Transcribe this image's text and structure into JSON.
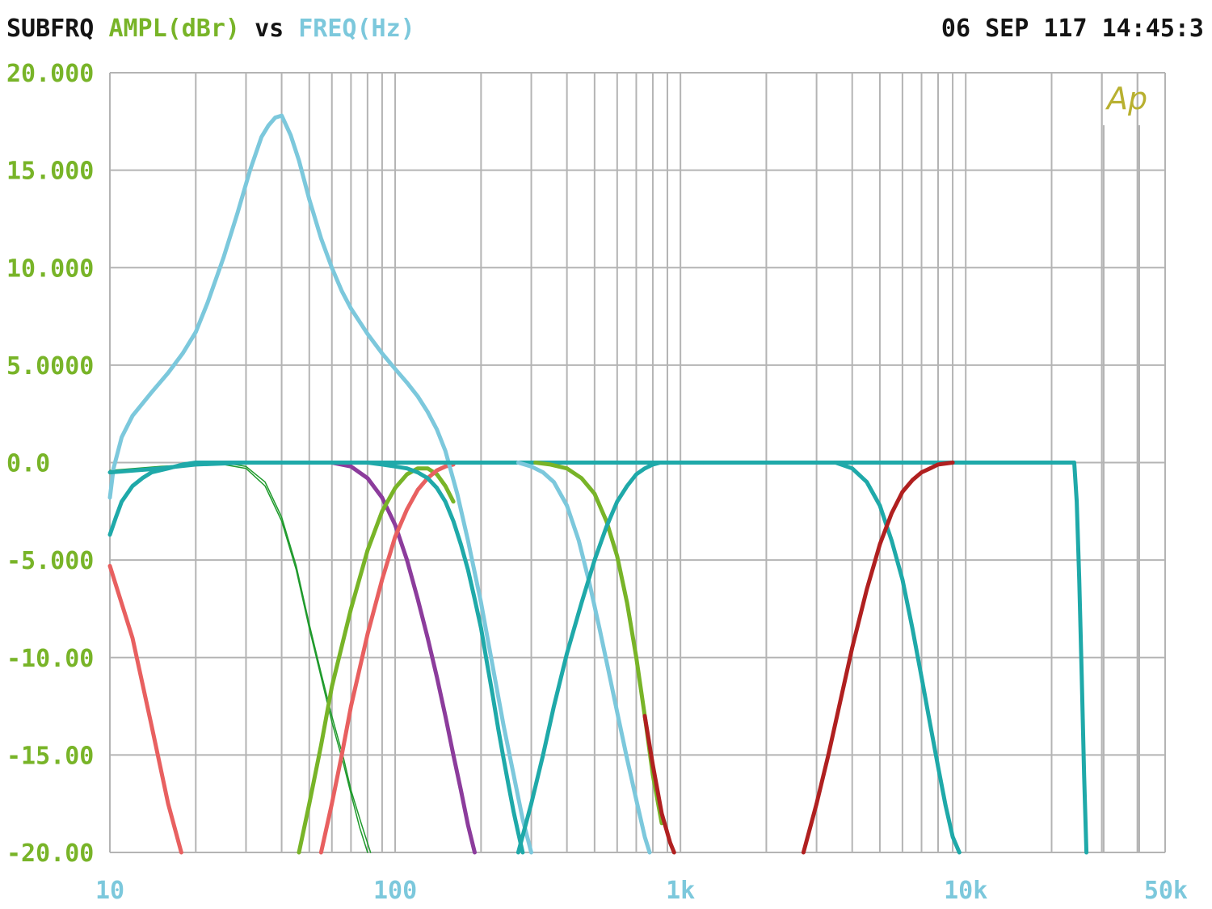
{
  "header": {
    "instrument": "SUBFRQ",
    "y_name": "AMPL(dBr)",
    "vs": "vs",
    "x_name": "FREQ(Hz)",
    "timestamp": "06 SEP 117 14:45:3"
  },
  "logo": "Ap",
  "colors": {
    "background": "#ffffff",
    "grid": "#b4b4b4",
    "y_axis_text": "#78b428",
    "x_axis_text": "#7cc8dc",
    "header_text": "#141414"
  },
  "chart_data": {
    "type": "line",
    "title": "",
    "xlabel": "FREQ(Hz)",
    "ylabel": "AMPL(dBr)",
    "x_scale": "log",
    "xlim": [
      10,
      50000
    ],
    "ylim": [
      -20,
      20
    ],
    "grid": true,
    "legend": "none",
    "x_tick_labels": [
      {
        "value": 10,
        "label": "10"
      },
      {
        "value": 100,
        "label": "100"
      },
      {
        "value": 1000,
        "label": "1k"
      },
      {
        "value": 10000,
        "label": "10k"
      },
      {
        "value": 50000,
        "label": "50k"
      }
    ],
    "y_tick_labels": [
      {
        "value": 20,
        "label": "20.000"
      },
      {
        "value": 15,
        "label": "15.000"
      },
      {
        "value": 10,
        "label": "10.000"
      },
      {
        "value": 5,
        "label": "5.0000"
      },
      {
        "value": 0,
        "label": "0.0"
      },
      {
        "value": -5,
        "label": "-5.000"
      },
      {
        "value": -10,
        "label": "-10.00"
      },
      {
        "value": -15,
        "label": "-15.00"
      },
      {
        "value": -20,
        "label": "-20.00"
      }
    ],
    "series": [
      {
        "color": "#e86060",
        "width": 5,
        "x": [
          10,
          12,
          14,
          16,
          17.8
        ],
        "y": [
          -5.3,
          -9,
          -13.5,
          -17.5,
          -20
        ]
      },
      {
        "color": "#1f9a2c",
        "width": 1.5,
        "x": [
          10,
          15,
          20,
          25,
          30,
          35,
          40,
          45,
          50,
          55,
          60,
          66,
          70,
          75,
          80
        ],
        "y": [
          -0.5,
          -0.3,
          -0.1,
          -0.1,
          -0.3,
          -1.2,
          -3,
          -5.5,
          -8.5,
          -11,
          -13.3,
          -15.5,
          -17,
          -18.7,
          -20
        ]
      },
      {
        "color": "#1f9a2c",
        "width": 1.5,
        "x": [
          10,
          15,
          20,
          25,
          30,
          35,
          40,
          45,
          50,
          55,
          60,
          66,
          70,
          76,
          82
        ],
        "y": [
          -0.4,
          -0.2,
          -0.1,
          0,
          -0.2,
          -1,
          -2.8,
          -5.3,
          -8.3,
          -10.8,
          -13,
          -15.2,
          -16.8,
          -18.5,
          -20
        ]
      },
      {
        "color": "#8c3c9c",
        "width": 5,
        "x": [
          40,
          50,
          60,
          70,
          80,
          90,
          100,
          110,
          120,
          130,
          140,
          150,
          160,
          170,
          180,
          190
        ],
        "y": [
          0,
          0,
          0,
          -0.2,
          -0.8,
          -1.8,
          -3.2,
          -5,
          -7,
          -9,
          -11,
          -13,
          -15,
          -16.8,
          -18.6,
          -20
        ]
      },
      {
        "color": "#78b428",
        "width": 5,
        "x": [
          46,
          50,
          55,
          60,
          70,
          80,
          90,
          100,
          110,
          120,
          130,
          140,
          150,
          160
        ],
        "y": [
          -20,
          -17.5,
          -14.5,
          -11.5,
          -7.5,
          -4.5,
          -2.5,
          -1.3,
          -0.6,
          -0.3,
          -0.3,
          -0.6,
          -1.2,
          -2
        ]
      },
      {
        "color": "#e86060",
        "width": 5,
        "x": [
          55,
          60,
          65,
          70,
          80,
          90,
          100,
          110,
          120,
          130,
          140,
          150,
          160
        ],
        "y": [
          -20,
          -17.5,
          -15,
          -12.5,
          -8.8,
          -6,
          -3.8,
          -2.4,
          -1.4,
          -0.8,
          -0.4,
          -0.2,
          -0.1
        ]
      },
      {
        "color": "#7cc8dc",
        "width": 5,
        "x": [
          10,
          10.3,
          11,
          12,
          14,
          16,
          18,
          20,
          22,
          25,
          28,
          31,
          34,
          36,
          38,
          40,
          43,
          46,
          50,
          55,
          60,
          65,
          70,
          80,
          90,
          100,
          110,
          120,
          130,
          140,
          150,
          165,
          180,
          200,
          220,
          240,
          260,
          280,
          300
        ],
        "y": [
          -1.8,
          -0.3,
          1.3,
          2.4,
          3.6,
          4.6,
          5.6,
          6.7,
          8.2,
          10.5,
          12.8,
          15,
          16.7,
          17.3,
          17.7,
          17.8,
          16.8,
          15.5,
          13.5,
          11.5,
          10,
          8.8,
          7.9,
          6.6,
          5.6,
          4.8,
          4.1,
          3.4,
          2.6,
          1.7,
          0.6,
          -1.6,
          -4,
          -7.2,
          -10.5,
          -13.5,
          -16,
          -18.3,
          -20
        ]
      },
      {
        "color": "#1fa9a9",
        "width": 5,
        "x": [
          10,
          10.5,
          11,
          12,
          13,
          14,
          16,
          18,
          20,
          25,
          30,
          40,
          50,
          60,
          70,
          80,
          90,
          100,
          110,
          120,
          130,
          140,
          150,
          160,
          170,
          180,
          190,
          200,
          210,
          220,
          230,
          240,
          250,
          260,
          270,
          280
        ],
        "y": [
          -3.7,
          -2.8,
          -2,
          -1.2,
          -0.8,
          -0.5,
          -0.3,
          -0.1,
          0,
          0,
          0,
          0,
          0,
          0,
          0,
          0,
          -0.1,
          -0.2,
          -0.3,
          -0.5,
          -0.8,
          -1.3,
          -2,
          -3,
          -4.2,
          -5.5,
          -7,
          -8.5,
          -10.3,
          -12,
          -13.7,
          -15.2,
          -16.6,
          -17.9,
          -19,
          -20
        ]
      },
      {
        "color": "#1fa9a9",
        "width": 5,
        "x": [
          10,
          15,
          20,
          30,
          40,
          60,
          100,
          200,
          300,
          500,
          800,
          1200,
          2000,
          3000,
          5000,
          8000,
          12000,
          20000,
          24000
        ],
        "y": [
          -0.5,
          -0.3,
          -0.1,
          0,
          0,
          0,
          0,
          0,
          0,
          0,
          0,
          0,
          0,
          0,
          0,
          0,
          0,
          0,
          0
        ]
      },
      {
        "color": "#7cc8dc",
        "width": 5,
        "x": [
          270,
          300,
          330,
          360,
          400,
          440,
          480,
          520,
          560,
          600,
          650,
          700,
          750,
          780
        ],
        "y": [
          0,
          -0.2,
          -0.5,
          -1,
          -2.2,
          -4,
          -6.2,
          -8.5,
          -10.7,
          -12.8,
          -15.2,
          -17.3,
          -19.2,
          -20
        ]
      },
      {
        "color": "#78b428",
        "width": 5,
        "x": [
          310,
          350,
          400,
          450,
          500,
          550,
          600,
          650,
          700,
          750,
          800,
          860
        ],
        "y": [
          0,
          -0.1,
          -0.3,
          -0.8,
          -1.6,
          -3,
          -4.8,
          -7.2,
          -10,
          -13,
          -16,
          -18.5
        ]
      },
      {
        "color": "#b02020",
        "width": 5,
        "x": [
          750,
          800,
          860,
          920,
          950
        ],
        "y": [
          -13,
          -15.5,
          -18,
          -19.5,
          -20
        ]
      },
      {
        "color": "#1fa9a9",
        "width": 5,
        "x": [
          270,
          300,
          330,
          360,
          400,
          450,
          500,
          550,
          600,
          650,
          700,
          750,
          800,
          850,
          900,
          1000,
          1200
        ],
        "y": [
          -20,
          -17.5,
          -15,
          -12.5,
          -9.8,
          -7.2,
          -5,
          -3.3,
          -2,
          -1.2,
          -0.6,
          -0.3,
          -0.1,
          0,
          0,
          0,
          0
        ]
      },
      {
        "color": "#1fa9a9",
        "width": 5,
        "x": [
          3500,
          4000,
          4500,
          5000,
          5500,
          6000,
          6500,
          7000,
          7500,
          8000,
          8500,
          9000,
          9500
        ],
        "y": [
          0,
          -0.3,
          -1,
          -2.2,
          -4,
          -6,
          -8.5,
          -11,
          -13.4,
          -15.6,
          -17.6,
          -19.2,
          -20
        ]
      },
      {
        "color": "#b02020",
        "width": 5,
        "x": [
          2700,
          3000,
          3300,
          3600,
          4000,
          4500,
          5000,
          5500,
          6000,
          6500,
          7000,
          7500,
          8000,
          9000
        ],
        "y": [
          -20,
          -17.5,
          -15,
          -12.5,
          -9.5,
          -6.5,
          -4.2,
          -2.6,
          -1.5,
          -0.9,
          -0.5,
          -0.3,
          -0.1,
          0
        ]
      },
      {
        "color": "#1fa9a9",
        "width": 5,
        "x": [
          24000,
          24500,
          25000,
          25500,
          26000,
          26500
        ],
        "y": [
          0,
          -2,
          -6,
          -11,
          -16,
          -20
        ]
      }
    ]
  }
}
